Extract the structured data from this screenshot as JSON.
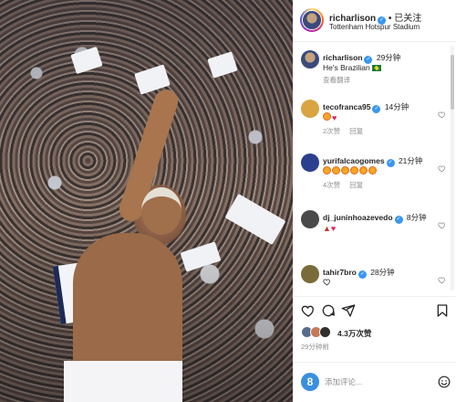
{
  "post": {
    "author": "richarlison",
    "follow_label": "已关注",
    "location": "Tottenham Hotspur Stadium",
    "caption": {
      "author": "richarlison",
      "time": "29分钟",
      "text": "He's Brazilian",
      "translate_label": "查看翻译"
    }
  },
  "comments": [
    {
      "user": "tecofranca95",
      "verified": true,
      "time": "14分钟",
      "text": "",
      "likes_label": "2次赞",
      "reply_label": "回复",
      "avatar_color": "#d9a441"
    },
    {
      "user": "yurifalcaogomes",
      "verified": true,
      "time": "21分钟",
      "text": "",
      "likes_label": "4次赞",
      "reply_label": "回复",
      "avatar_color": "#2b3f8f"
    },
    {
      "user": "dj_juninhoazevedo",
      "verified": true,
      "time": "8分钟",
      "text": "",
      "avatar_color": "#4a4a4a"
    },
    {
      "user": "tahir7bro",
      "verified": true,
      "time": "28分钟",
      "text": "",
      "avatar_color": "#7a6b3a"
    }
  ],
  "likes": {
    "count_label": "4.3万次赞"
  },
  "posted_time": "29分钟前",
  "composer": {
    "placeholder": "添加评论..."
  },
  "icons": [
    "heart-icon",
    "comment-icon",
    "share-icon",
    "bookmark-icon",
    "emoji-icon",
    "verified-badge-icon",
    "flag-brazil-icon"
  ],
  "colors": {
    "verified": "#3897f0",
    "muted_text": "#8e8e8e",
    "heart": "#e0245e"
  }
}
